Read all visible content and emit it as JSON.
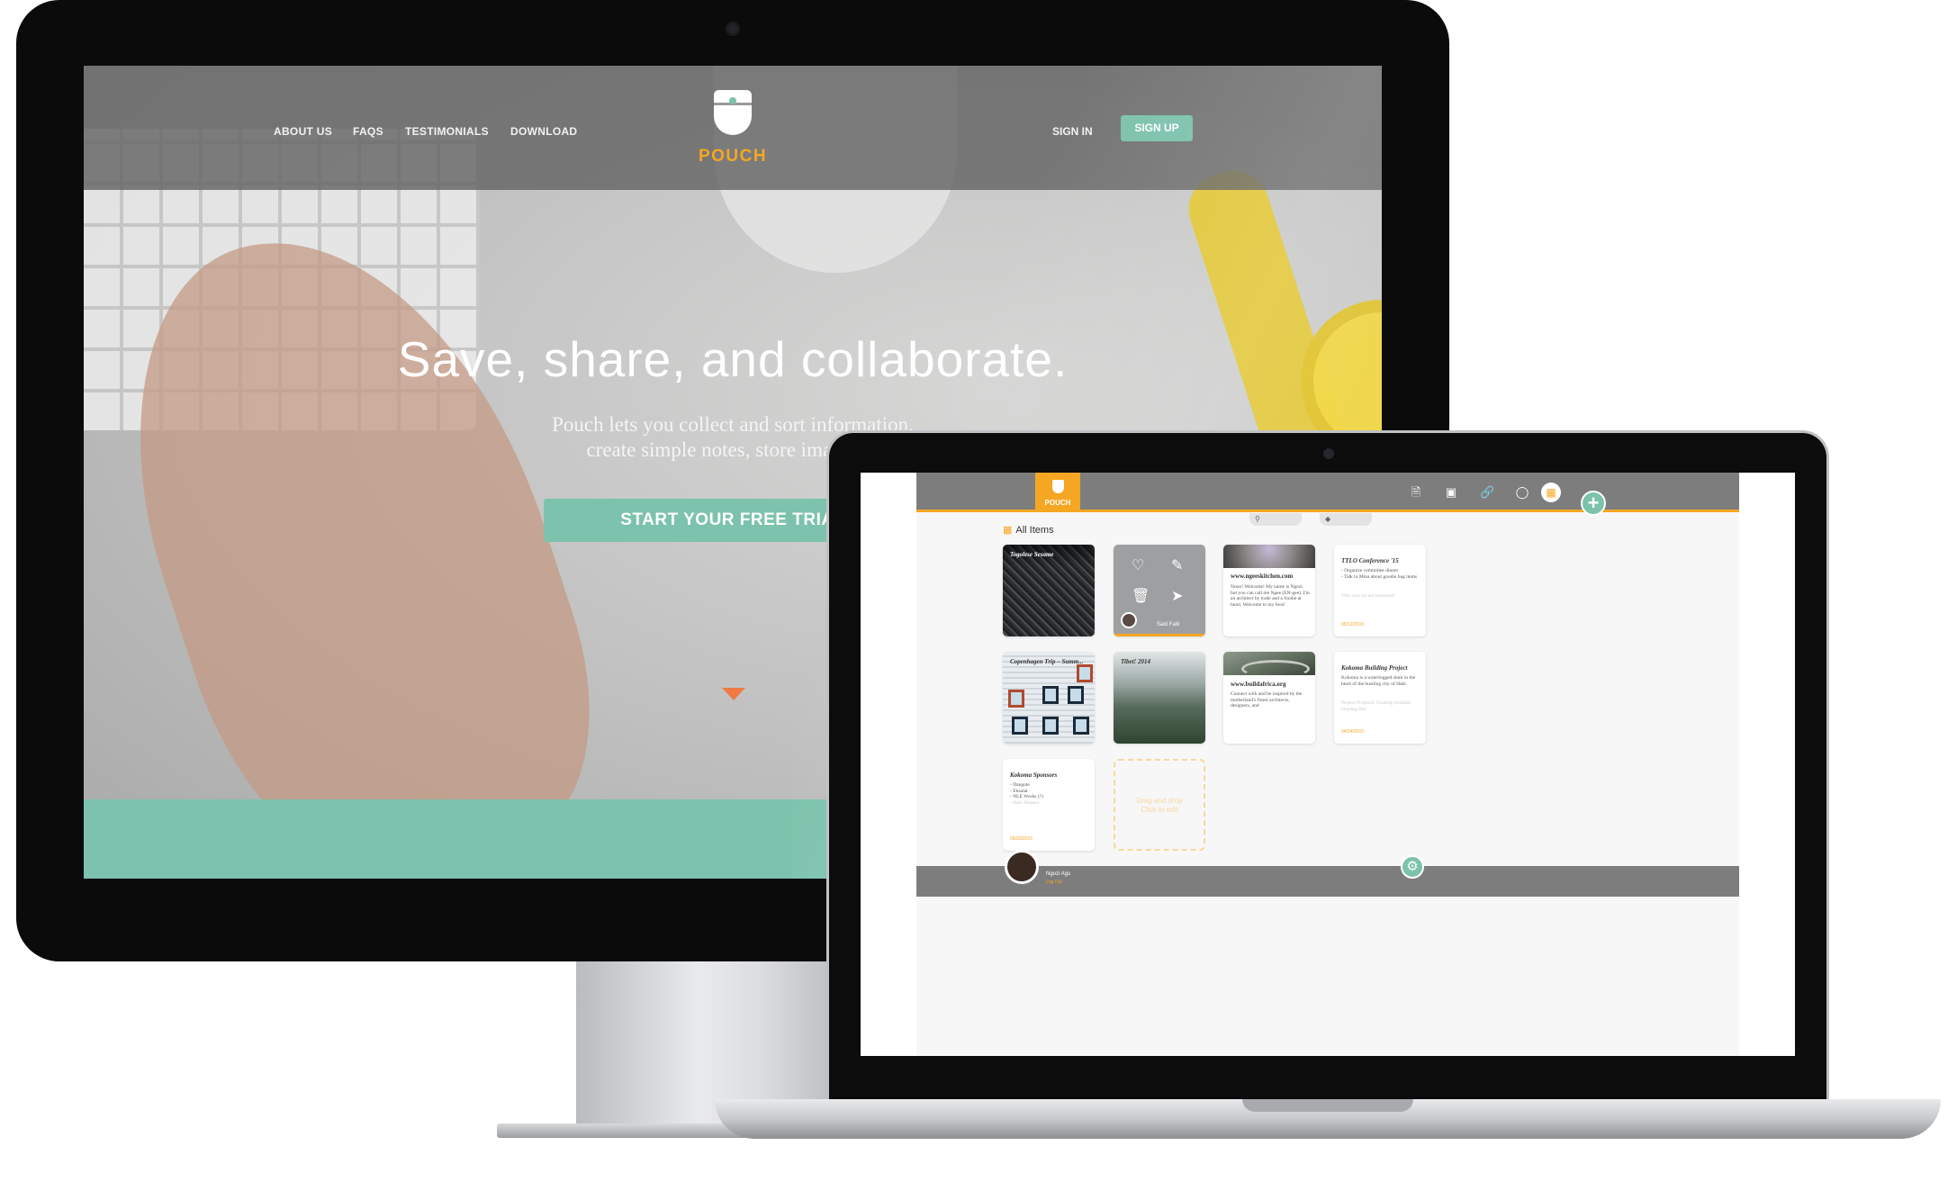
{
  "website": {
    "nav": {
      "about": "ABOUT US",
      "faqs": "FAQS",
      "testimonials": "TESTIMONIALS",
      "download": "DOWNLOAD",
      "sign_in": "SIGN IN",
      "sign_up": "SIGN UP"
    },
    "logo_text": "POUCH",
    "hero_title": "Save, share, and collaborate.",
    "hero_subtitle_line1": "Pouch lets you collect and sort information,",
    "hero_subtitle_line2": "create simple notes, store images, a",
    "cta": "START YOUR FREE TRIAL"
  },
  "app": {
    "logo_text": "POUCH",
    "toolbar_icons": [
      "note-icon",
      "image-icon",
      "link-icon",
      "pouch-icon",
      "grid-icon"
    ],
    "section_title": "All Items",
    "cards": {
      "togolese": {
        "title": "Togolese Sesame"
      },
      "hover": {
        "owner": "Said Fabi"
      },
      "ngees": {
        "url": "www.ngeeskitchen.com",
        "body": "Nnoo! Welcome! My name is Ngozi but you can call me Ngee (EN-gee). I'm an architect by trade and a foodie at heart. Welcome to my food"
      },
      "ttlo": {
        "title": "TTLO Conference '15",
        "items": [
          "- Organize committee dinner",
          "- Talk to Mina about goodie bag items"
        ],
        "faded": "This year we are honoured",
        "date": "05/12/2015"
      },
      "copenhagen": {
        "title": "Copenhagen Trip – Summ..."
      },
      "tibet": {
        "title": "Tibet! 2014"
      },
      "buildafrica": {
        "url": "www.buildafrica.org",
        "body": "Connect with and be inspired by the motherland's finest architects, designers, and"
      },
      "kokoma_building": {
        "title": "Kokoma Building Project",
        "body": "Kokoma is a waterlogged slum in the heart of the bustling city of Habi",
        "faded": "Project Proposal: Floating modular housing that",
        "date": "04/24/2015"
      },
      "kokoma_sponsors": {
        "title": "Kokoma Sponsors",
        "items": [
          "- Dangote",
          "- Etisalat",
          "- NLE Works (?)",
          "- Habi Helpers"
        ],
        "date": "05/20/2015"
      },
      "drop_zone": {
        "line1": "Drag and drop",
        "line2": "Click to edit"
      }
    },
    "user": {
      "name": "Ngozi Agu",
      "logout": "Log Out"
    }
  },
  "colors": {
    "accent_orange": "#f5a623",
    "accent_teal": "#7cc2ac",
    "app_bar_gray": "#7d7d7d"
  }
}
